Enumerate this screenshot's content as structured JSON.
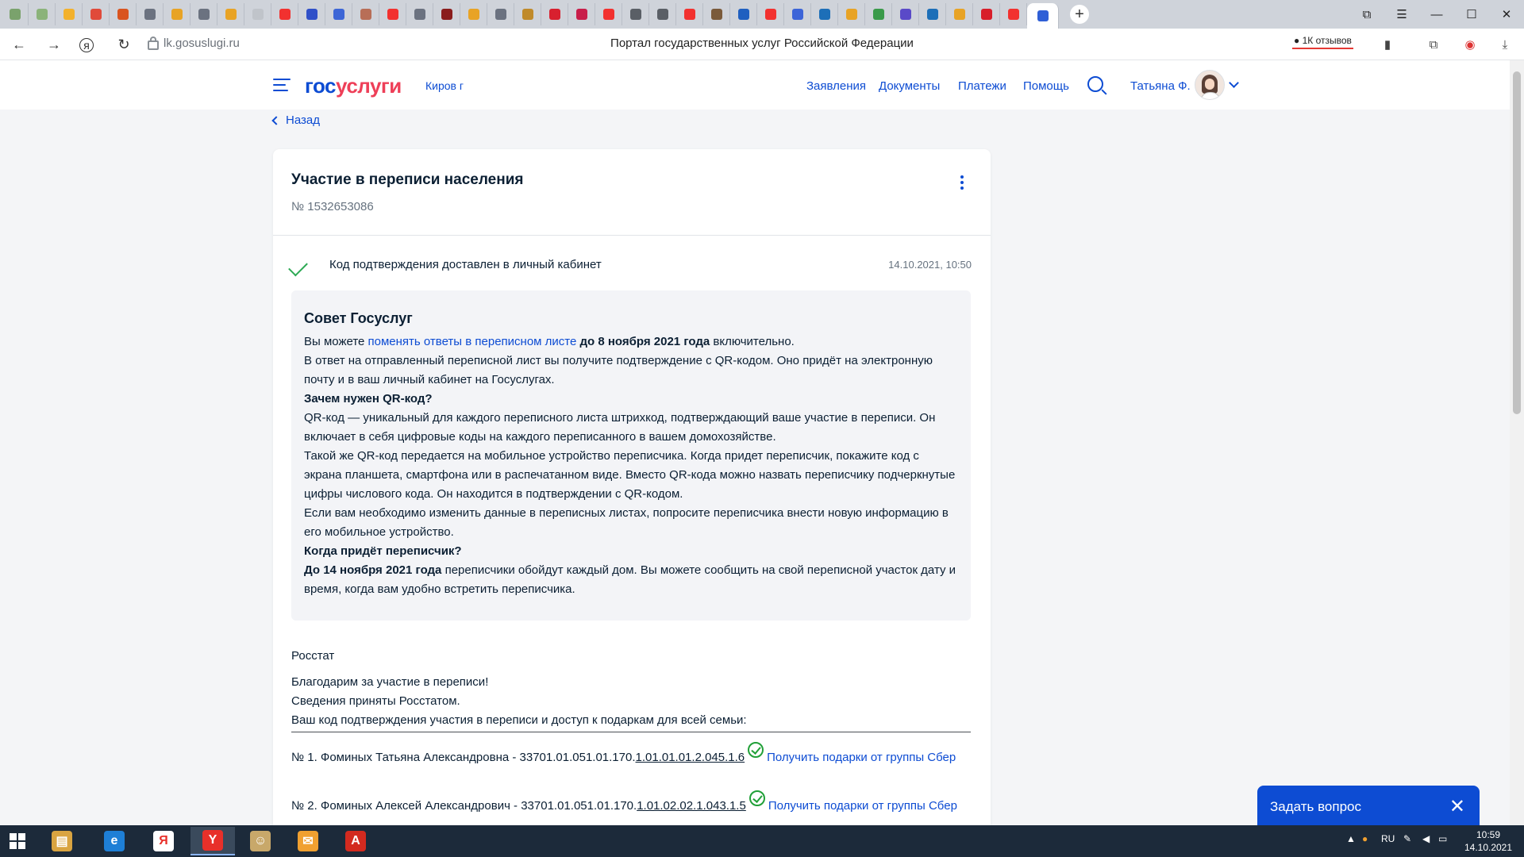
{
  "browser": {
    "url": "lk.gosuslugi.ru",
    "page_title": "Портал государственных услуг Российской Федерации",
    "reviews_label": "1К отзывов",
    "tab_colors": [
      "#7aa26c",
      "#8bb37a",
      "#f3b12c",
      "#e04a3a",
      "#d9541f",
      "#6b7280",
      "#e8a325",
      "#6b7280",
      "#e8a325",
      "#c0c4ca",
      "#f2312f",
      "#3050c8",
      "#3d66d6",
      "#b86e57",
      "#f2312f",
      "#6b7280",
      "#8a1c1c",
      "#e8a325",
      "#6b7280",
      "#c08a2a",
      "#d8202f",
      "#c81e4a",
      "#f2312f",
      "#5a5f66",
      "#5a5f66",
      "#f2312f",
      "#7a5a3a",
      "#1f5fc0",
      "#f2312f",
      "#3c64d8",
      "#1d6fb8",
      "#e8a325",
      "#3a9a4a",
      "#5a4ac8",
      "#1d6fb8",
      "#e8a325",
      "#d81e2a",
      "#f2312f"
    ],
    "active_tab_color": "#2f5fd6",
    "new_tab_icon": "+",
    "win_buttons": [
      "⧉",
      "☰",
      "—",
      "☐",
      "✕"
    ]
  },
  "header": {
    "logo_part1": "гос",
    "logo_part2": "услуги",
    "city": "Киров г",
    "nav": [
      "Заявления",
      "Документы",
      "Платежи",
      "Помощь"
    ],
    "username": "Татьяна Ф."
  },
  "back_label": "Назад",
  "application": {
    "title": "Участие в переписи населения",
    "number": "№ 1532653086",
    "status_text": "Код подтверждения доставлен в личный кабинет",
    "status_date": "14.10.2021, 10:50"
  },
  "advice": {
    "heading": "Совет Госуслуг",
    "p1_a": "Вы можете ",
    "p1_link": "поменять ответы в переписном листе",
    "p1_b": " до 8 ноября 2021 года",
    "p1_c": " включительно.",
    "p2": "В ответ на отправленный переписной лист вы получите подтверждение с QR-кодом. Оно придёт на электронную почту и в ваш личный кабинет на Госуслугах.",
    "q1": "Зачем нужен QR-код?",
    "p3": "QR-код — уникальный для каждого переписного листа штрихкод, подтверждающий ваше участие в переписи. Он включает в себя цифровые коды на каждого переписанного в вашем домохозяйстве.",
    "p4": "Такой же QR-код передается на мобильное устройство переписчика. Когда придет переписчик, покажите код с экрана планшета, смартфона или в распечатанном виде. Вместо QR-кода можно назвать переписчику подчеркнутые цифры числового кода. Он находится в подтверждении с QR-кодом.",
    "p5": "Если вам необходимо изменить данные в переписных листах, попросите переписчика внести новую информацию в его мобильное устройство.",
    "q2": "Когда придёт переписчик?",
    "p6_b": "До 14 ноября 2021 года",
    "p6": " переписчики обойдут каждый дом. Вы можете сообщить на свой переписной участок дату и время, когда вам удобно встретить переписчика."
  },
  "rosstat": {
    "label": "Росстат",
    "line1": "Благодарим за участие в переписи!",
    "line2": "Сведения приняты Росстатом.",
    "line3": "Ваш код подтверждения участия в переписи и доступ к подаркам для всей семьи:"
  },
  "members": [
    {
      "prefix": "№ 1. Фоминых Татьяна Александровна - 33701.01.051.01.170.",
      "code": "1.01.01.01.2.045.1.6",
      "link": "Получить подарки от группы Сбер"
    },
    {
      "prefix": "№ 2. Фоминых Алексей Александрович - 33701.01.051.01.170.",
      "code": "1.01.02.02.1.043.1.5",
      "link": "Получить подарки от группы Сбер"
    }
  ],
  "chat": {
    "label": "Задать вопрос",
    "close": "✕"
  },
  "taskbar": {
    "apps": [
      {
        "color": "#d9a441",
        "glyph": "▤"
      },
      {
        "color": "#1e7fd6",
        "glyph": "e"
      },
      {
        "color": "#ffffff",
        "glyph": "Я"
      },
      {
        "color": "#e8302a",
        "glyph": "Y"
      },
      {
        "color": "#c8a86a",
        "glyph": "☺"
      },
      {
        "color": "#f0a030",
        "glyph": "✉"
      },
      {
        "color": "#d32a1f",
        "glyph": "A"
      }
    ],
    "tray_lang": "RU",
    "time": "10:59",
    "date": "14.10.2021"
  }
}
